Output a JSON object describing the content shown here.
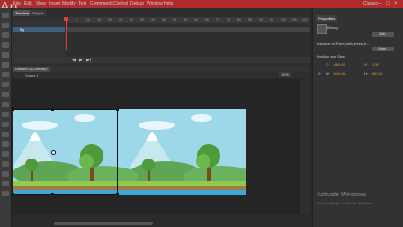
{
  "app": {
    "logo_text": "An",
    "menu": [
      "File",
      "Edit",
      "View",
      "Insert",
      "Modify",
      "Text",
      "Commands",
      "Control",
      "Debug",
      "Window",
      "Help"
    ],
    "workspace": "Classic"
  },
  "timeline": {
    "tabs": [
      "Timeline",
      "Output"
    ],
    "layer_name": "Bg",
    "frame_numbers": [
      "5",
      "10",
      "15",
      "20",
      "25",
      "30",
      "35",
      "40",
      "45",
      "50",
      "55",
      "60",
      "65",
      "70",
      "75",
      "80",
      "85",
      "90",
      "95",
      "100",
      "105",
      "110"
    ]
  },
  "document": {
    "tab_label": "Untitled-1 (Canvas)*",
    "scene_label": "Scene 1",
    "zoom": "50%"
  },
  "properties": {
    "tab": "Properties",
    "type_label": "Bitmap",
    "instance_label": "Instance of:  Field_with_trees_b...",
    "swap_button": "Swap...",
    "edit_button": "Edit...",
    "section": "Position and Size",
    "x_value": "-489.45",
    "y_value": "0.00",
    "w_value": "1024.00",
    "h_value": "480.00"
  },
  "os_watermark": {
    "title": "Activate Windows",
    "subtitle": "Go to Settings to activate Windows."
  },
  "colors": {
    "accent_playhead": "#e83d3d",
    "layer_highlight": "#3e5f80",
    "value_orange": "#e39a3b"
  }
}
